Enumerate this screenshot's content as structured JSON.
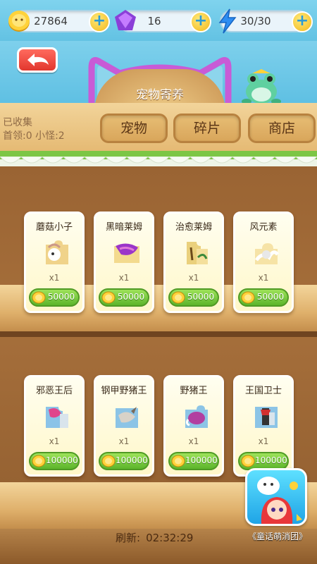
{
  "resources": {
    "coins": "27864",
    "gems": "16",
    "energy": "30/30",
    "plus_label": "+"
  },
  "header": {
    "title": "宠物寄养",
    "collection_label": "已收集",
    "collection_counts": "首领:0 小怪:2"
  },
  "tabs": [
    {
      "label": "宠物"
    },
    {
      "label": "碎片"
    },
    {
      "label": "商店"
    }
  ],
  "shelf1": [
    {
      "name": "蘑菇小子",
      "qty": "x1",
      "price": "50000",
      "icon": "puzzle-fragment-icon"
    },
    {
      "name": "黑暗莱姆",
      "qty": "x1",
      "price": "50000",
      "icon": "puzzle-fragment-icon"
    },
    {
      "name": "治愈莱姆",
      "qty": "x1",
      "price": "50000",
      "icon": "puzzle-fragment-icon"
    },
    {
      "name": "风元素",
      "qty": "x1",
      "price": "50000",
      "icon": "puzzle-fragment-icon"
    }
  ],
  "shelf2": [
    {
      "name": "邪恶王后",
      "qty": "x1",
      "price": "100000",
      "icon": "puzzle-fragment-icon"
    },
    {
      "name": "钢甲野猪王",
      "qty": "x1",
      "price": "100000",
      "icon": "puzzle-fragment-icon"
    },
    {
      "name": "野猪王",
      "qty": "x1",
      "price": "100000",
      "icon": "puzzle-fragment-icon"
    },
    {
      "name": "王国卫士",
      "qty": "x1",
      "price": "100000",
      "icon": "puzzle-fragment-icon"
    }
  ],
  "footer": {
    "refresh_label": "刷新:",
    "refresh_time": "02:32:29",
    "app_name": "《童话萌消团》"
  },
  "colors": {
    "sky": "#63c2e3",
    "wood": "#e3b66e",
    "price_green": "#5cb52b",
    "back_red": "#e2372e"
  }
}
